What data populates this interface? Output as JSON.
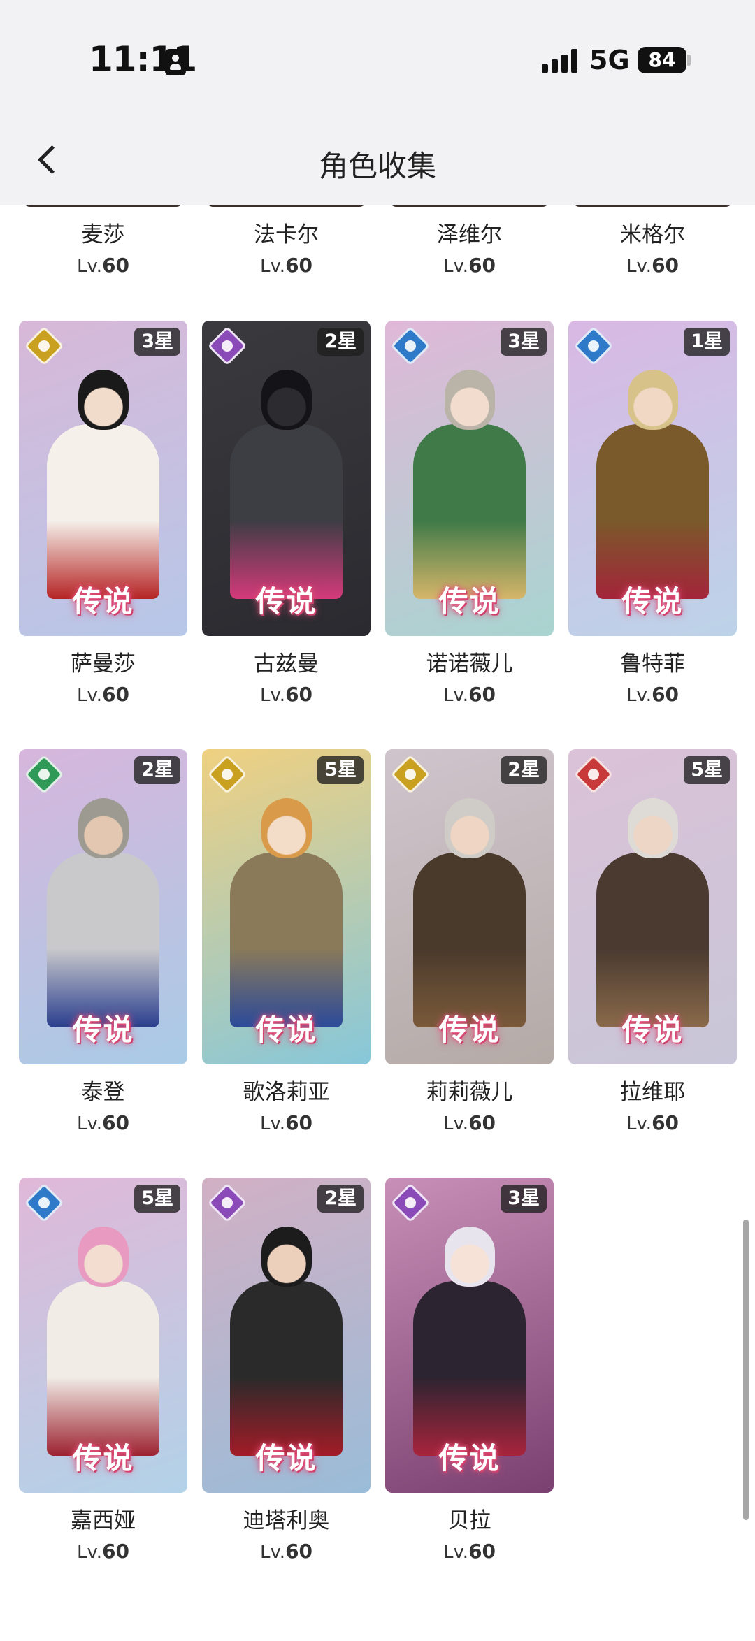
{
  "status_bar": {
    "time": "11:11",
    "network": "5G",
    "battery": "84"
  },
  "header": {
    "title": "角色收集"
  },
  "grid": {
    "lv_prefix": "Lv.",
    "legend_label": "传说",
    "top_row": [
      {
        "name": "麦莎",
        "level": "60"
      },
      {
        "name": "法卡尔",
        "level": "60"
      },
      {
        "name": "泽维尔",
        "level": "60"
      },
      {
        "name": "米格尔",
        "level": "60"
      }
    ],
    "cards": [
      {
        "name": "萨曼莎",
        "level": "60",
        "stars": "3星",
        "element": "gold-element-icon",
        "bg": [
          "#d8b8d8",
          "#b7c7e8"
        ],
        "skin": "#f1dccb",
        "hair": "#1a1a1a",
        "outfit": "#f5f1ea",
        "accent": "#b52424"
      },
      {
        "name": "古兹曼",
        "level": "60",
        "stars": "2星",
        "element": "purple-element-icon",
        "bg": [
          "#3a3a3e",
          "#2a2a30"
        ],
        "skin": "#2c2c30",
        "hair": "#141418",
        "outfit": "#3d3d44",
        "accent": "#d43a7a"
      },
      {
        "name": "诺诺薇儿",
        "level": "60",
        "stars": "3星",
        "element": "blue-element-icon",
        "bg": [
          "#e0b8d8",
          "#a8d4d0"
        ],
        "skin": "#f2dccd",
        "hair": "#b9b3a8",
        "outfit": "#3f7a48",
        "accent": "#d6b66a"
      },
      {
        "name": "鲁特菲",
        "level": "60",
        "stars": "1星",
        "element": "blue-element-icon",
        "bg": [
          "#d9b8e4",
          "#bcd3e8"
        ],
        "skin": "#f0d8c4",
        "hair": "#d7c28a",
        "outfit": "#7a5a2a",
        "accent": "#a4243a"
      },
      {
        "name": "泰登",
        "level": "60",
        "stars": "2星",
        "element": "green-element-icon",
        "bg": [
          "#d7b6dc",
          "#a9cbe6"
        ],
        "skin": "#e4c7b0",
        "hair": "#9d9a92",
        "outfit": "#c9c9cc",
        "accent": "#2a3e8e"
      },
      {
        "name": "歌洛莉亚",
        "level": "60",
        "stars": "5星",
        "element": "gold-element-icon",
        "bg": [
          "#f0d080",
          "#86c7da"
        ],
        "skin": "#f3dcc8",
        "hair": "#d99a4a",
        "outfit": "#8a7a5a",
        "accent": "#2b4a9a"
      },
      {
        "name": "莉莉薇儿",
        "level": "60",
        "stars": "2星",
        "element": "gold-element-icon",
        "bg": [
          "#cfc4cc",
          "#b4aaa6"
        ],
        "skin": "#efd5c3",
        "hair": "#cfcbc6",
        "outfit": "#4a3a2c",
        "accent": "#7a5a3a"
      },
      {
        "name": "拉维耶",
        "level": "60",
        "stars": "5星",
        "element": "red-element-icon",
        "bg": [
          "#dbc2d8",
          "#c8c6d8"
        ],
        "skin": "#eed6c6",
        "hair": "#dedad6",
        "outfit": "#4a3a30",
        "accent": "#8a6a4a"
      },
      {
        "name": "嘉西娅",
        "level": "60",
        "stars": "5星",
        "element": "blue-element-icon",
        "bg": [
          "#e0b8d8",
          "#b2d2e8"
        ],
        "skin": "#f3dcd0",
        "hair": "#e89ac0",
        "outfit": "#f1ece6",
        "accent": "#9c2230"
      },
      {
        "name": "迪塔利奥",
        "level": "60",
        "stars": "2星",
        "element": "purple-element-icon",
        "bg": [
          "#d2b0c4",
          "#9abcd8"
        ],
        "skin": "#ecd0bc",
        "hair": "#1c1c1c",
        "outfit": "#2a2a2a",
        "accent": "#a31c28"
      },
      {
        "name": "贝拉",
        "level": "60",
        "stars": "3星",
        "element": "purple-element-icon",
        "bg": [
          "#c890b8",
          "#7a4070"
        ],
        "skin": "#f6e2d6",
        "hair": "#e8e4ee",
        "outfit": "#2c2430",
        "accent": "#a8243c"
      }
    ]
  },
  "colors": {
    "element_gold": "#c9a020",
    "element_purple": "#8a4ab8",
    "element_blue": "#2f7ac8",
    "element_green": "#2f9a58",
    "element_red": "#c83a3a"
  }
}
